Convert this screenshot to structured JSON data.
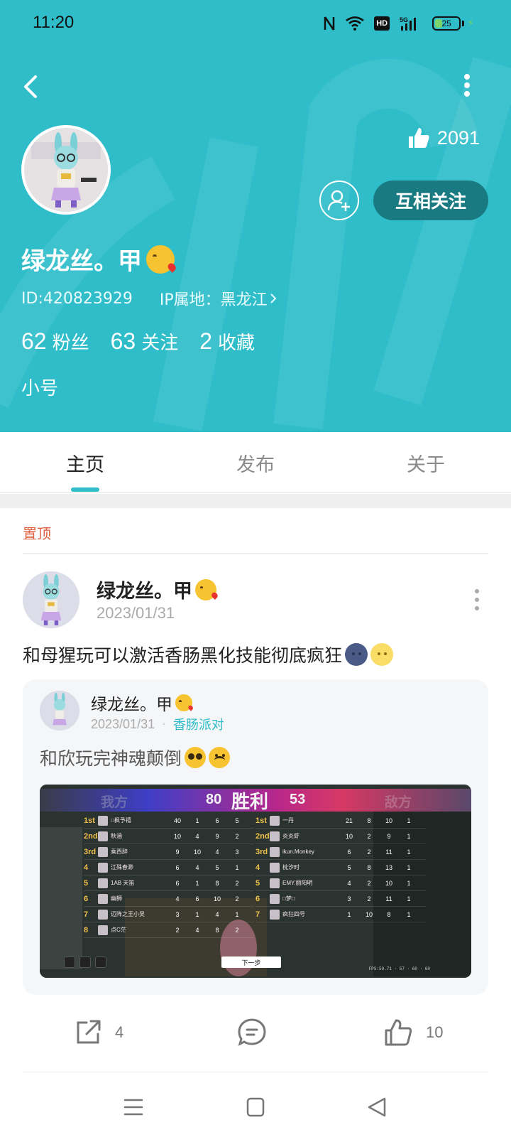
{
  "status_bar": {
    "time": "11:20",
    "network": "5G",
    "hd": "HD",
    "battery": "25"
  },
  "profile": {
    "likes": "2091",
    "name": "绿龙丝。甲",
    "id_label": "ID:420823929",
    "ip_label": "IP属地：黑龙江",
    "stats": [
      {
        "num": "62",
        "label": "粉丝"
      },
      {
        "num": "63",
        "label": "关注"
      },
      {
        "num": "2",
        "label": "收藏"
      }
    ],
    "bio": "小号",
    "follow_button": "互相关注"
  },
  "tabs": [
    {
      "label": "主页",
      "active": true
    },
    {
      "label": "发布",
      "active": false
    },
    {
      "label": "关于",
      "active": false
    }
  ],
  "pinned_label": "置顶",
  "post": {
    "author": "绿龙丝。甲",
    "date": "2023/01/31",
    "text": "和母猩玩可以激活香肠黑化技能彻底疯狂",
    "shared": {
      "author": "绿龙丝。甲",
      "date": "2023/01/31",
      "topic": "香肠派对",
      "text": "和欣玩完神魂颠倒",
      "game": {
        "left_side": "我方",
        "right_side": "敌方",
        "left_score": "80",
        "right_score": "53",
        "result": "胜利",
        "next_button": "下一步",
        "left_rows": [
          {
            "rank": "1st",
            "name": "□枫予禧",
            "c1": "40",
            "c2": "1",
            "c3": "6",
            "c4": "5"
          },
          {
            "rank": "2nd",
            "name": "秋涵",
            "c1": "10",
            "c2": "4",
            "c3": "9",
            "c4": "2"
          },
          {
            "rank": "3rd",
            "name": "乘西辞",
            "c1": "9",
            "c2": "10",
            "c3": "4",
            "c4": "3"
          },
          {
            "rank": "4",
            "name": "江殊春渺",
            "c1": "6",
            "c2": "4",
            "c3": "5",
            "c4": "1"
          },
          {
            "rank": "5",
            "name": "1AB 天笛",
            "c1": "6",
            "c2": "1",
            "c3": "8",
            "c4": "2"
          },
          {
            "rank": "6",
            "name": "幽狮",
            "c1": "4",
            "c2": "6",
            "c3": "10",
            "c4": "2"
          },
          {
            "rank": "7",
            "name": "迈阵之王小吴",
            "c1": "3",
            "c2": "1",
            "c3": "4",
            "c4": "1"
          },
          {
            "rank": "8",
            "name": "点C茫",
            "c1": "2",
            "c2": "4",
            "c3": "8",
            "c4": "2"
          }
        ],
        "right_rows": [
          {
            "rank": "1st",
            "name": "一丹",
            "c1": "21",
            "c2": "8",
            "c3": "10",
            "c4": "1"
          },
          {
            "rank": "2nd",
            "name": "炎炎虾",
            "c1": "10",
            "c2": "2",
            "c3": "9",
            "c4": "1"
          },
          {
            "rank": "3rd",
            "name": "ikun.Monkey",
            "c1": "6",
            "c2": "2",
            "c3": "11",
            "c4": "1"
          },
          {
            "rank": "4",
            "name": "枕汐时",
            "c1": "5",
            "c2": "8",
            "c3": "13",
            "c4": "1"
          },
          {
            "rank": "5",
            "name": "EMY.丽阳明",
            "c1": "4",
            "c2": "2",
            "c3": "10",
            "c4": "1"
          },
          {
            "rank": "6",
            "name": "□梦□",
            "c1": "3",
            "c2": "2",
            "c3": "11",
            "c4": "1"
          },
          {
            "rank": "7",
            "name": "疯狂四号",
            "c1": "1",
            "c2": "10",
            "c3": "8",
            "c4": "1"
          }
        ],
        "fps": "FPS:59.71 · 57 · 60 · 60"
      }
    },
    "actions": {
      "share_count": "4",
      "like_count": "10"
    }
  }
}
